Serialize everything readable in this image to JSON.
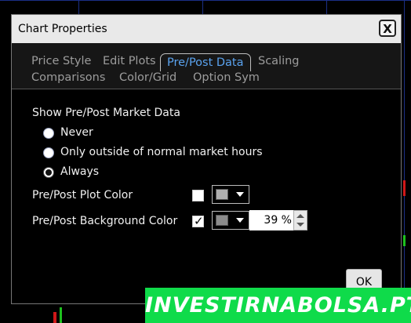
{
  "window": {
    "title": "Chart Properties",
    "close_label": "X"
  },
  "tabs": [
    {
      "label": "Price Style"
    },
    {
      "label": "Edit Plots"
    },
    {
      "label": "Pre/Post Data"
    },
    {
      "label": "Scaling"
    },
    {
      "label": "Comparisons"
    },
    {
      "label": "Color/Grid"
    },
    {
      "label": "Option Sym"
    }
  ],
  "active_tab": "Pre/Post Data",
  "show_market_data": {
    "heading": "Show Pre/Post Market Data",
    "options": [
      {
        "label": "Never",
        "selected": false
      },
      {
        "label": "Only outside of normal market hours",
        "selected": false
      },
      {
        "label": "Always",
        "selected": true
      }
    ]
  },
  "plot_color": {
    "label": "Pre/Post Plot Color",
    "checked": false,
    "swatch_color": "#b0b0b0"
  },
  "background_color": {
    "label": "Pre/Post Background Color",
    "checked": true,
    "checkmark": "✓",
    "swatch_color": "#8c8c8c",
    "opacity_value": "39 %"
  },
  "ok_label": "OK",
  "watermark": "INVESTIRNABOLSA.PT",
  "colors": {
    "active_tab": "#5aa2ee",
    "watermark_bg": "#0fdb4a"
  }
}
